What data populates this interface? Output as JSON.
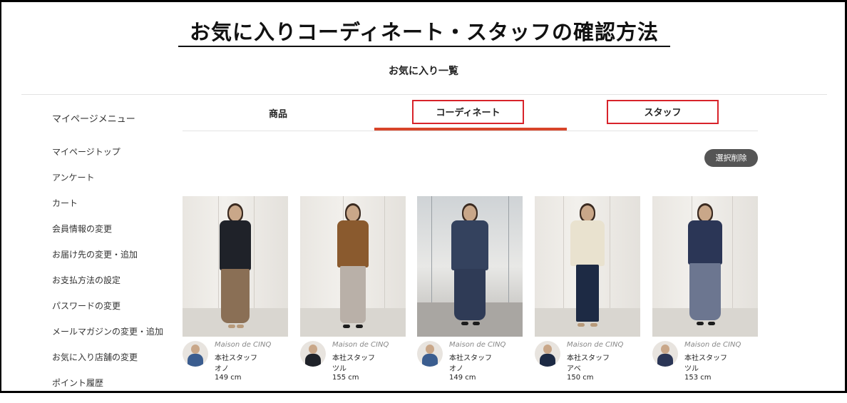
{
  "headline": "お気に入りコーディネート・スタッフの確認方法",
  "page_title": "お気に入り一覧",
  "menu": {
    "heading": "マイページメニュー",
    "items": [
      "マイページトップ",
      "アンケート",
      "カート",
      "会員情報の変更",
      "お届け先の変更・追加",
      "お支払方法の設定",
      "パスワードの変更",
      "メールマガジンの変更・追加",
      "お気に入り店舗の変更",
      "ポイント履歴"
    ]
  },
  "tabs": {
    "products": "商品",
    "coordinate": "コーディネート",
    "staff": "スタッフ",
    "active": "coordinate"
  },
  "delete_button": "選択削除",
  "colors": {
    "accent_red": "#d8232a",
    "tab_underline": "#d8452a",
    "button_bg": "#555555"
  },
  "cards": [
    {
      "brand": "Maison de CINQ",
      "store": "本社スタッフ",
      "name": "オノ",
      "height": "149 cm"
    },
    {
      "brand": "Maison de CINQ",
      "store": "本社スタッフ",
      "name": "ツル",
      "height": "155 cm"
    },
    {
      "brand": "Maison de CINQ",
      "store": "本社スタッフ",
      "name": "オノ",
      "height": "149 cm"
    },
    {
      "brand": "Maison de CINQ",
      "store": "本社スタッフ",
      "name": "アベ",
      "height": "150 cm"
    },
    {
      "brand": "Maison de CINQ",
      "store": "本社スタッフ",
      "name": "ツル",
      "height": "153 cm"
    }
  ]
}
